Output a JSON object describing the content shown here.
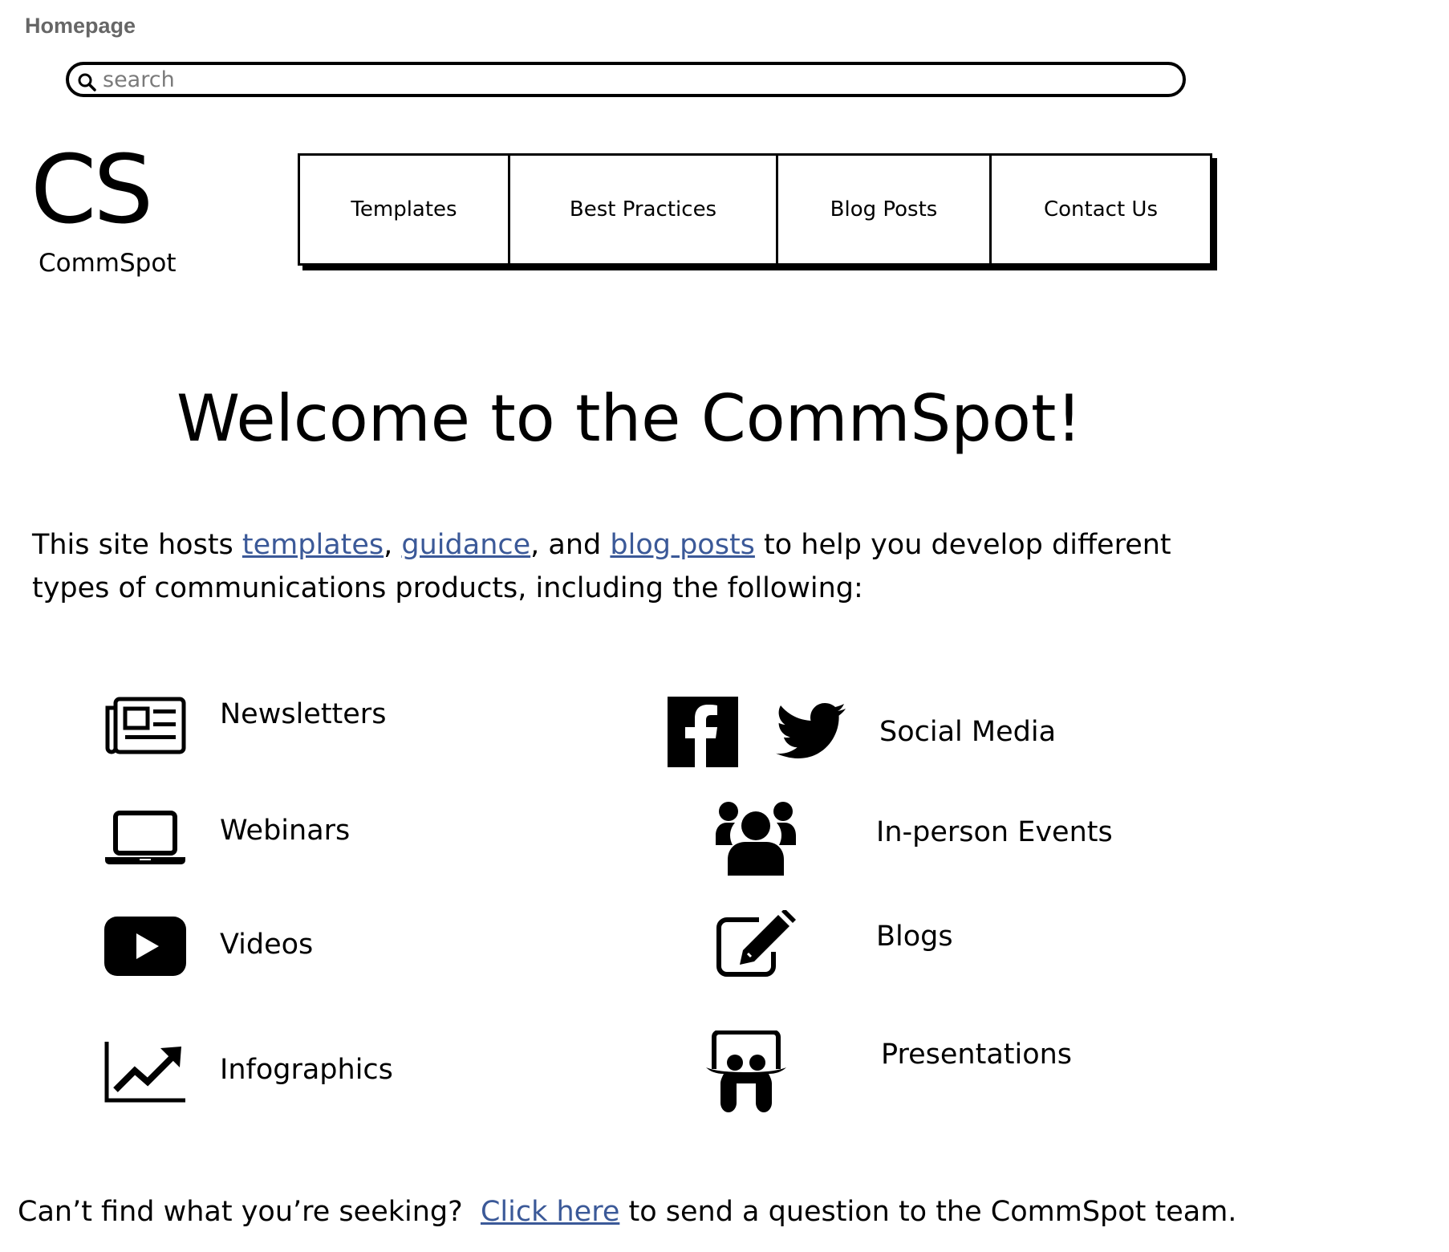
{
  "page": {
    "label": "Homepage"
  },
  "search": {
    "placeholder": "search",
    "value": ""
  },
  "logo": {
    "mark": "CS",
    "name": "CommSpot"
  },
  "nav": {
    "items": [
      {
        "label": "Templates"
      },
      {
        "label": "Best Practices"
      },
      {
        "label": "Blog Posts"
      },
      {
        "label": "Contact Us"
      }
    ]
  },
  "main": {
    "headline": "Welcome to the CommSpot!",
    "intro": {
      "part1": "This site hosts ",
      "link_templates": "templates",
      "sep1": ", ",
      "link_guidance": "guidance",
      "sep2": ", and ",
      "link_blog_posts": "blog posts",
      "part2": " to help you develop different types of communications products, including the following:"
    },
    "products": [
      {
        "label": "Newsletters",
        "icon": "newspaper-icon"
      },
      {
        "label": "Webinars",
        "icon": "laptop-icon"
      },
      {
        "label": "Videos",
        "icon": "youtube-icon"
      },
      {
        "label": "Infographics",
        "icon": "chart-line-icon"
      },
      {
        "label": "Social Media",
        "icon": "facebook-twitter-icon"
      },
      {
        "label": "In-person Events",
        "icon": "people-group-icon"
      },
      {
        "label": "Blogs",
        "icon": "edit-pencil-icon"
      },
      {
        "label": "Presentations",
        "icon": "slideshare-icon"
      }
    ]
  },
  "footer": {
    "prefix": "Can’t find what you’re seeking?  ",
    "link": "Click here",
    "suffix": " to send a question to the CommSpot team."
  },
  "colors": {
    "link": "#3b5998",
    "page_label": "#666666"
  }
}
